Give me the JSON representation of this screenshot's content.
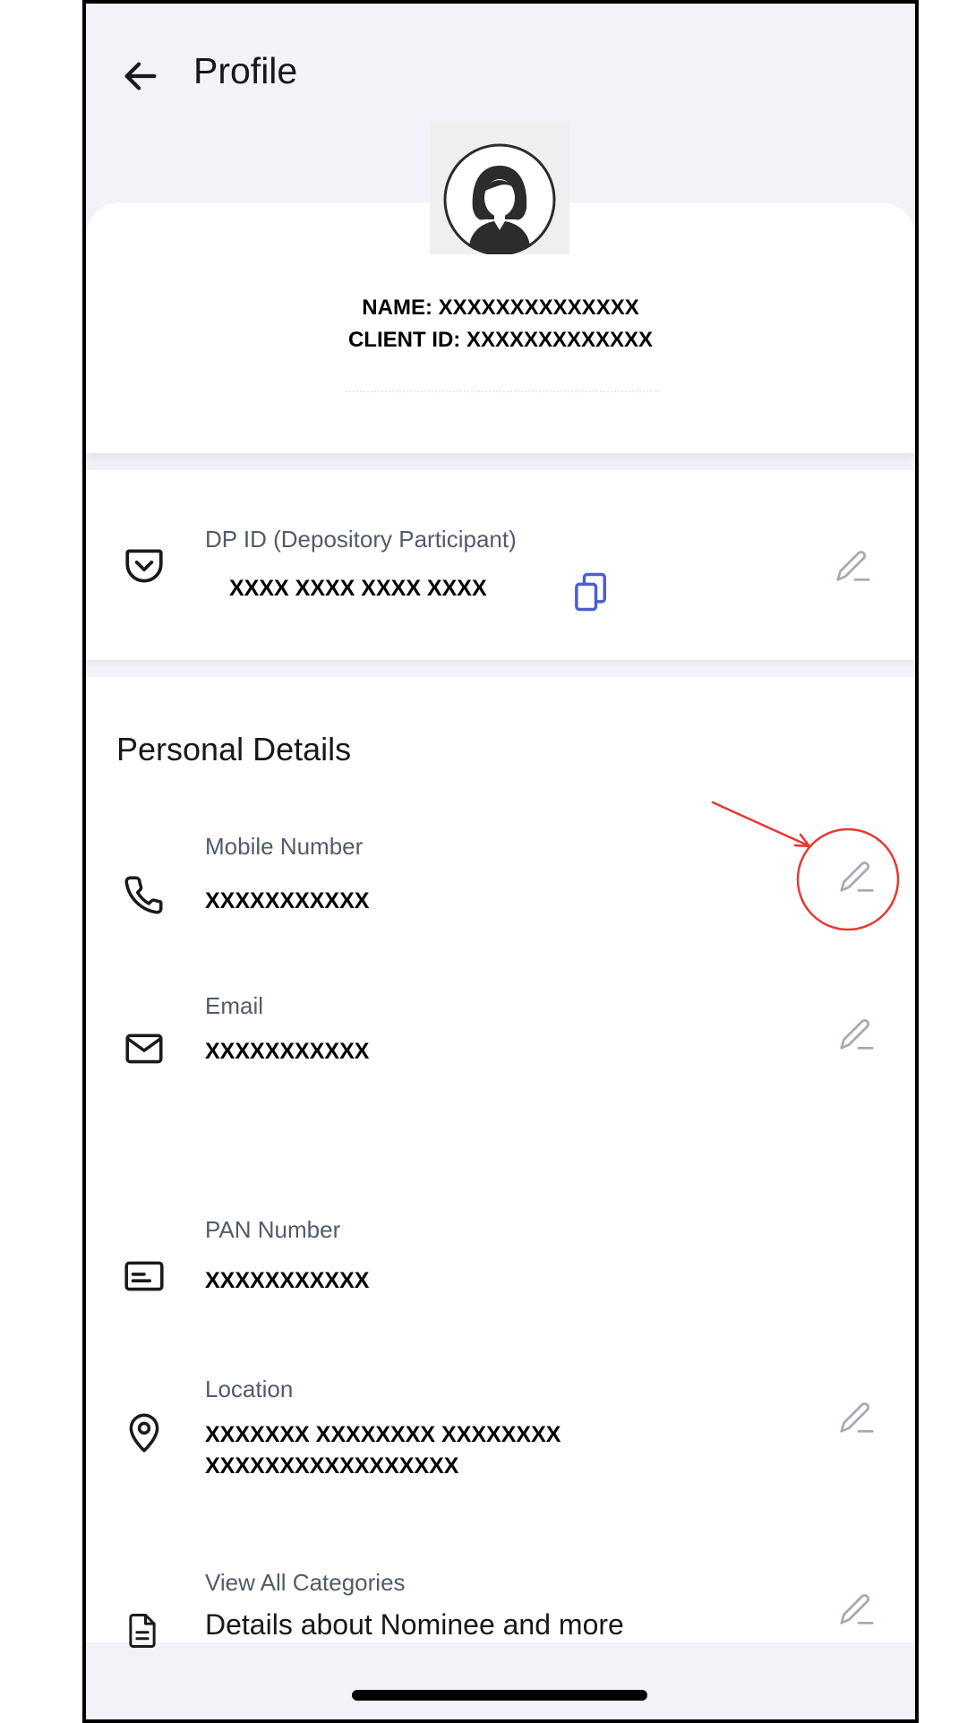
{
  "header": {
    "title": "Profile"
  },
  "profile": {
    "name_line": "NAME: XXXXXXXXXXXXXX",
    "client_line": "CLIENT ID: XXXXXXXXXXXXX"
  },
  "dp": {
    "label": "DP ID (Depository Participant)",
    "value": "XXXX XXXX XXXX XXXX"
  },
  "personal": {
    "title": "Personal Details",
    "mobile": {
      "label": "Mobile Number",
      "value": "XXXXXXXXXXX"
    },
    "email": {
      "label": "Email",
      "value": "XXXXXXXXXXX"
    },
    "pan": {
      "label": "PAN Number",
      "value": "XXXXXXXXXXX"
    },
    "location": {
      "label": "Location",
      "line1": "XXXXXXX XXXXXXXX XXXXXXXX",
      "line2": "XXXXXXXXXXXXXXXXX"
    },
    "categories": {
      "label": "View All Categories",
      "value": "Details about Nominee and more"
    }
  },
  "colors": {
    "page_bg": "#f2f3f8",
    "accent_copy": "#4a5fd0",
    "annotation_red": "#e53935",
    "label_gray": "#535a69"
  },
  "icons": {
    "back": "arrow-left-icon",
    "dp": "pocket-icon",
    "copy": "copy-icon",
    "edit": "pencil-icon",
    "mobile": "phone-icon",
    "email": "mail-icon",
    "pan": "id-card-icon",
    "location": "map-pin-icon",
    "categories": "document-icon"
  }
}
